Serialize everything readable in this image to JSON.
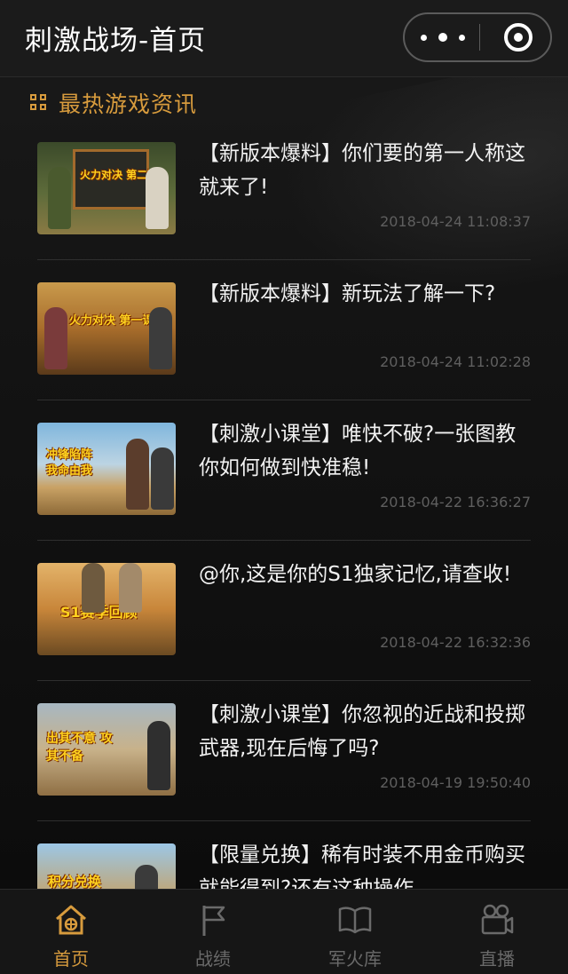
{
  "nav": {
    "title": "刺激战场-首页"
  },
  "section": {
    "title": "最热游戏资讯",
    "icon": "grid-icon"
  },
  "news": [
    {
      "headline": "【新版本爆料】你们要的第一人称这就来了!",
      "date": "2018-04-24 11:08:37",
      "thumb_text": "火力对决 第二课"
    },
    {
      "headline": "【新版本爆料】新玩法了解一下?",
      "date": "2018-04-24 11:02:28",
      "thumb_text": "火力对决 第一课"
    },
    {
      "headline": "【刺激小课堂】唯快不破?一张图教你如何做到快准稳!",
      "date": "2018-04-22 16:36:27",
      "thumb_text": "冲锋陷阵 我命由我"
    },
    {
      "headline": "@你,这是你的S1独家记忆,请查收!",
      "date": "2018-04-22 16:32:36",
      "thumb_text": "S1赛季回顾"
    },
    {
      "headline": "【刺激小课堂】你忽视的近战和投掷武器,现在后悔了吗?",
      "date": "2018-04-19 19:50:40",
      "thumb_text": "出其不意 攻其不备"
    },
    {
      "headline": "【限量兑换】稀有时装不用金币购买就能得到?还有这种操作",
      "date": "",
      "thumb_text": "积分兑换"
    }
  ],
  "tabs": [
    {
      "label": "首页",
      "icon": "home-icon",
      "active": true
    },
    {
      "label": "战绩",
      "icon": "flag-icon",
      "active": false
    },
    {
      "label": "军火库",
      "icon": "book-icon",
      "active": false
    },
    {
      "label": "直播",
      "icon": "video-camera-icon",
      "active": false
    }
  ],
  "colors": {
    "accent": "#d79b3d",
    "inactive": "#6a6a6a",
    "background": "#0b0b0b"
  }
}
